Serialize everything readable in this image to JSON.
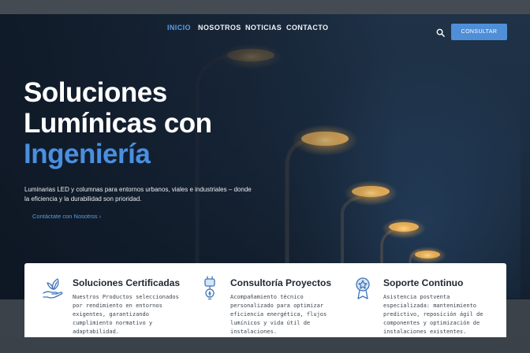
{
  "nav": {
    "items": [
      {
        "label": "INICIO",
        "active": true
      },
      {
        "label": "NOSOTROS",
        "active": false
      },
      {
        "label": "NOTICIAS",
        "active": false
      },
      {
        "label": "CONTACTO",
        "active": false
      }
    ],
    "search_icon": "search-icon",
    "cta_label": "CONSULTAR"
  },
  "hero": {
    "title_line1": "Soluciones",
    "title_line2": "Lumínicas con",
    "title_accent": "Ingeniería",
    "lead": "Luminarias LED y columnas para entornos urbanos, viales e industriales – donde la eficiencia y la durabilidad son prioridad.",
    "link_label": "Contáctate con Nosotros ›"
  },
  "features": [
    {
      "icon": "leaf-hand-icon",
      "title": "Soluciones Certificadas",
      "text": "Nuestros Productos seleccionados por rendimiento en entornos exigentes, garantizando cumplimiento normativo y adaptabilidad."
    },
    {
      "icon": "lightbulb-plug-icon",
      "title": "Consultoría Proyectos",
      "text": "Acompañamiento técnico personalizado para optimizar eficiencia energética, flujos lumínicos y vida útil de instalaciones."
    },
    {
      "icon": "award-ribbon-icon",
      "title": "Soporte Continuo",
      "text": "Asistencia postventa especializada: mantenimiento predictivo, reposición ágil de componentes y optimización de instalaciones existentes."
    }
  ],
  "colors": {
    "accent": "#4a8fe0",
    "button": "#4f8fd8",
    "hero_bg": "#1c2e43",
    "lamp_glow": "#f2c46a"
  }
}
